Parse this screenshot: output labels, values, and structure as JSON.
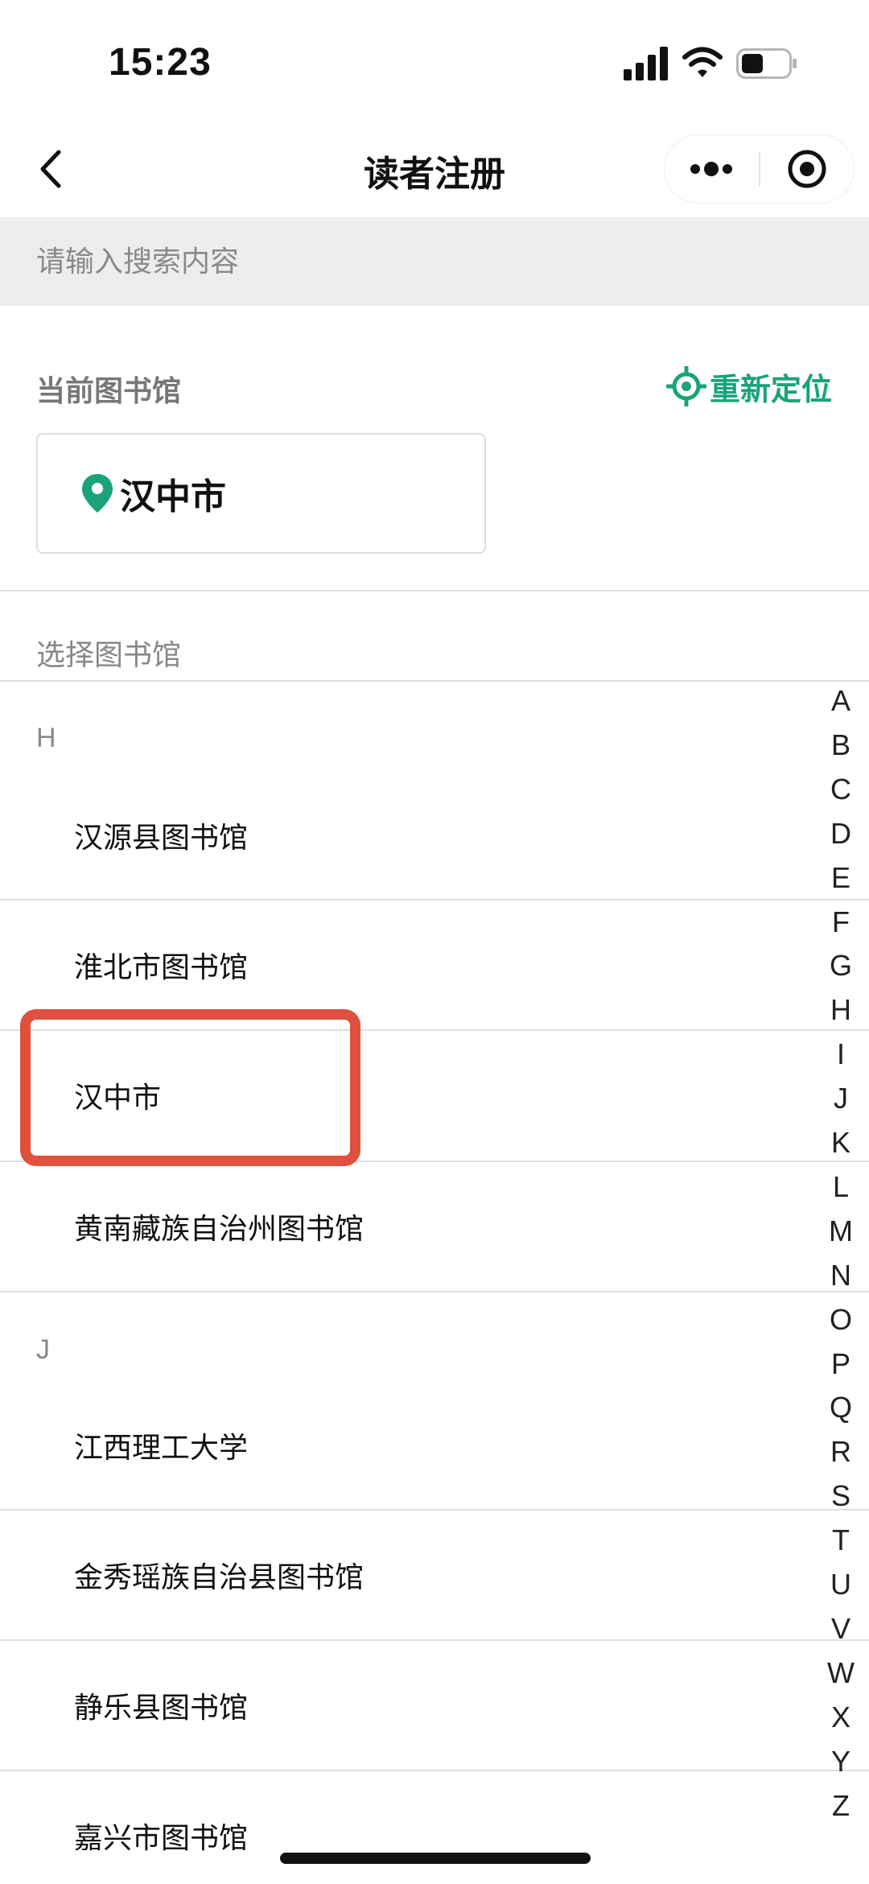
{
  "status_bar": {
    "time": "15:23",
    "icons": [
      "signal-icon",
      "wifi-icon",
      "battery-icon"
    ]
  },
  "nav": {
    "title": "读者注册",
    "icons": [
      "back-chevron-icon",
      "more-dots-icon",
      "target-icon"
    ]
  },
  "search": {
    "placeholder": "请输入搜索内容"
  },
  "current_library": {
    "label": "当前图书馆",
    "relocate_label": "重新定位",
    "city": "汉中市",
    "accent_color": "#1aa37a"
  },
  "select_library": {
    "label": "选择图书馆",
    "groups": [
      {
        "letter": "H",
        "items": [
          "汉源县图书馆",
          "淮北市图书馆",
          "汉中市",
          "黄南藏族自治州图书馆"
        ]
      },
      {
        "letter": "J",
        "items": [
          "江西理工大学",
          "金秀瑶族自治县图书馆",
          "静乐县图书馆",
          "嘉兴市图书馆"
        ]
      }
    ],
    "highlighted_item": "汉中市",
    "highlight_color": "#e0503e"
  },
  "index_letters": [
    "A",
    "B",
    "C",
    "D",
    "E",
    "F",
    "G",
    "H",
    "I",
    "J",
    "K",
    "L",
    "M",
    "N",
    "O",
    "P",
    "Q",
    "R",
    "S",
    "T",
    "U",
    "V",
    "W",
    "X",
    "Y",
    "Z"
  ]
}
